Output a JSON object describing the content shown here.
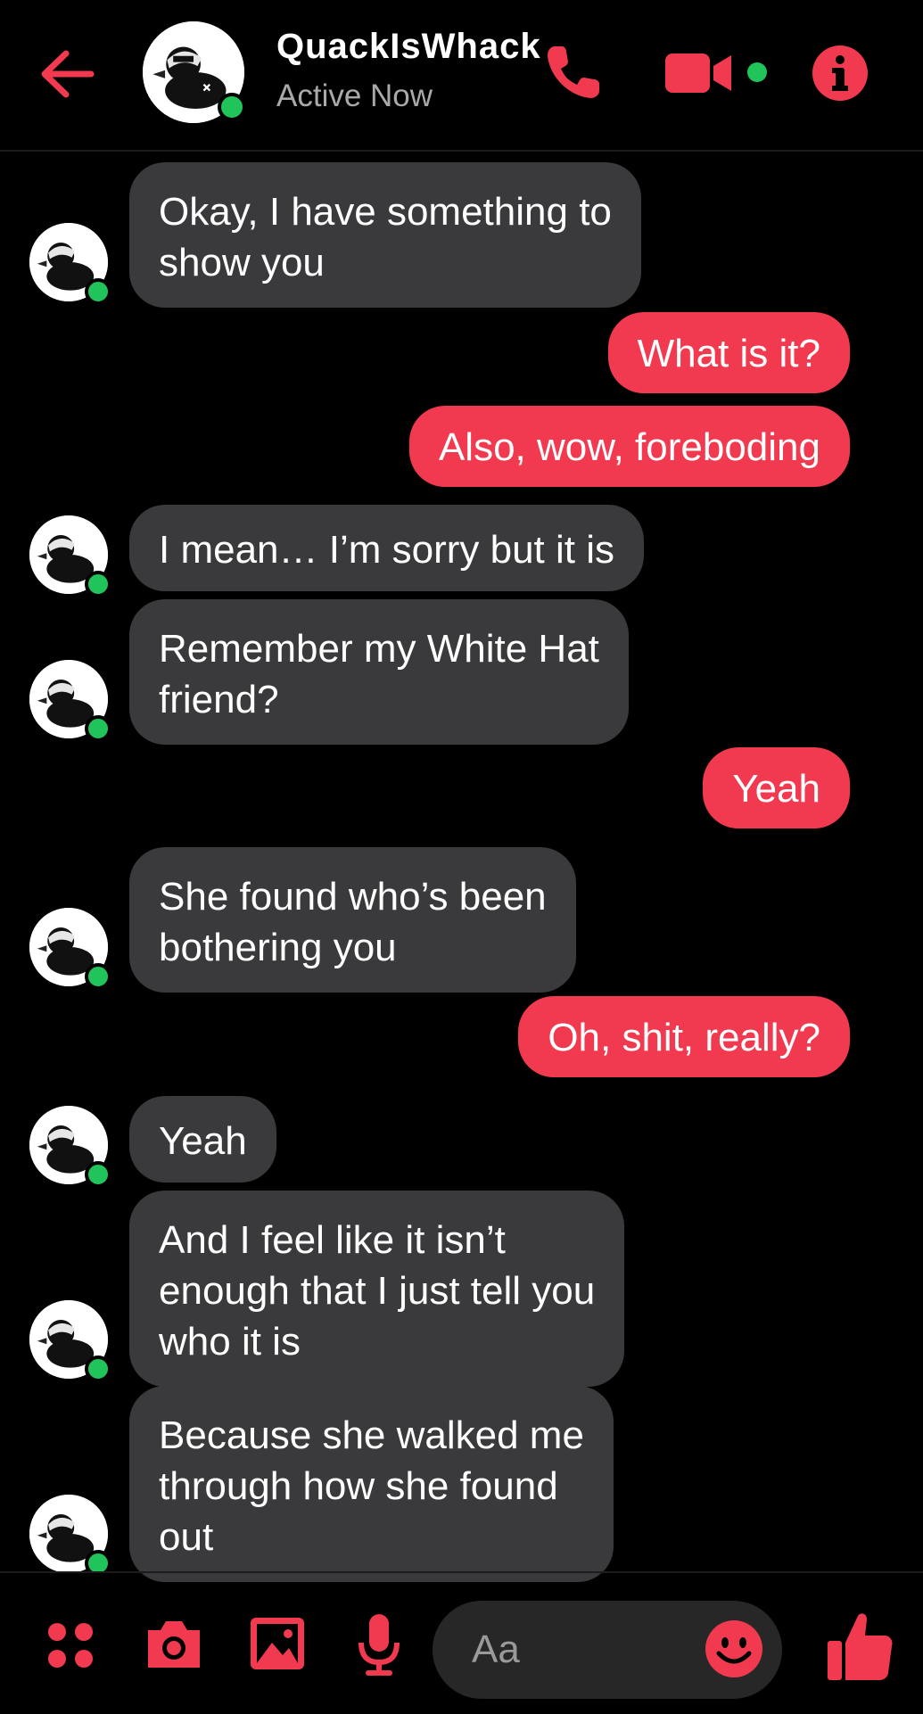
{
  "contact": {
    "name": "QuackIsWhack",
    "status": "Active Now"
  },
  "colors": {
    "accent": "#f13a4f",
    "incoming_bubble": "#3a3a3c",
    "presence": "#21c45a",
    "background": "#000000"
  },
  "icons": {
    "back": "arrow-left-icon",
    "call": "phone-icon",
    "video": "video-camera-icon",
    "info": "info-icon",
    "apps": "four-dots-icon",
    "camera": "camera-icon",
    "gallery": "image-icon",
    "mic": "microphone-icon",
    "emoji": "smiley-icon",
    "like": "thumbs-up-icon"
  },
  "messages": [
    {
      "from": "contact",
      "lines": [
        "Okay, I have something to",
        "show you"
      ]
    },
    {
      "from": "me",
      "lines": [
        "What is it?"
      ]
    },
    {
      "from": "me",
      "lines": [
        "Also, wow, foreboding"
      ]
    },
    {
      "from": "contact",
      "lines": [
        "I mean… I’m sorry but it is"
      ]
    },
    {
      "from": "contact",
      "lines": [
        "Remember my White Hat",
        "friend?"
      ]
    },
    {
      "from": "me",
      "lines": [
        "Yeah"
      ]
    },
    {
      "from": "contact",
      "lines": [
        "She found who’s been",
        "bothering you"
      ]
    },
    {
      "from": "me",
      "lines": [
        "Oh, shit, really?"
      ]
    },
    {
      "from": "contact",
      "lines": [
        "Yeah"
      ]
    },
    {
      "from": "contact",
      "lines": [
        "And I feel like it isn’t",
        "enough that I just tell you",
        "who it is"
      ]
    },
    {
      "from": "contact",
      "lines": [
        "Because she walked me",
        "through how she found",
        "out"
      ]
    }
  ],
  "composer": {
    "placeholder": "Aa"
  }
}
